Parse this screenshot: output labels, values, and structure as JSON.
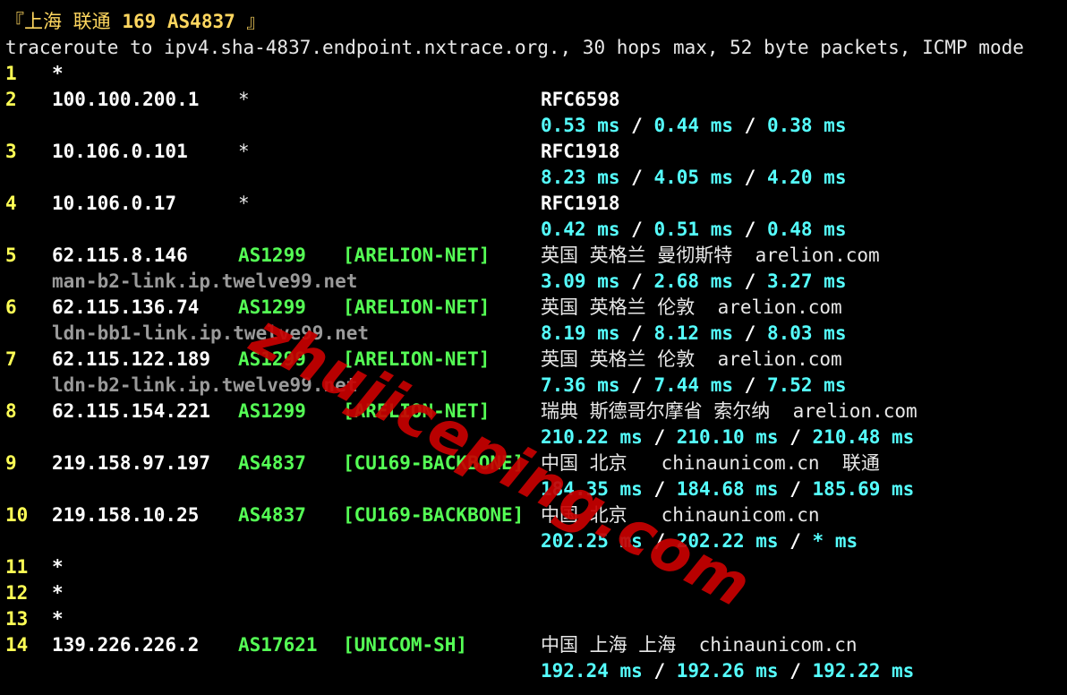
{
  "header": {
    "bracket_open": "『",
    "location": "上海 联通",
    "route": "169 AS4837",
    "bracket_close": "』"
  },
  "command_line": "traceroute to ipv4.sha-4837.endpoint.nxtrace.org., 30 hops max, 52 byte packets, ICMP mode",
  "hops": [
    {
      "num": "1",
      "ip": "*"
    },
    {
      "num": "2",
      "ip": "100.100.200.1",
      "asn": "*",
      "geo": "RFC6598",
      "rtt1": "0.53 ms",
      "rtt2": "0.44 ms",
      "rtt3": "0.38 ms",
      "sep": "/"
    },
    {
      "num": "3",
      "ip": "10.106.0.101",
      "asn": "*",
      "geo": "RFC1918",
      "rtt1": "8.23 ms",
      "rtt2": "4.05 ms",
      "rtt3": "4.20 ms",
      "sep": "/"
    },
    {
      "num": "4",
      "ip": "10.106.0.17",
      "asn": "*",
      "geo": "RFC1918",
      "rtt1": "0.42 ms",
      "rtt2": "0.51 ms",
      "rtt3": "0.48 ms",
      "sep": "/"
    },
    {
      "num": "5",
      "ip": "62.115.8.146",
      "asn": "AS1299",
      "net": "[ARELION-NET]",
      "geo": "英国 英格兰 曼彻斯特  arelion.com",
      "host": "man-b2-link.ip.twelve99.net",
      "rtt1": "3.09 ms",
      "rtt2": "2.68 ms",
      "rtt3": "3.27 ms",
      "sep": "/"
    },
    {
      "num": "6",
      "ip": "62.115.136.74",
      "asn": "AS1299",
      "net": "[ARELION-NET]",
      "geo": "英国 英格兰 伦敦  arelion.com",
      "host": "ldn-bb1-link.ip.twelve99.net",
      "rtt1": "8.19 ms",
      "rtt2": "8.12 ms",
      "rtt3": "8.03 ms",
      "sep": "/"
    },
    {
      "num": "7",
      "ip": "62.115.122.189",
      "asn": "AS1299",
      "net": "[ARELION-NET]",
      "geo": "英国 英格兰 伦敦  arelion.com",
      "host": "ldn-b2-link.ip.twelve99.net",
      "rtt1": "7.36 ms",
      "rtt2": "7.44 ms",
      "rtt3": "7.52 ms",
      "sep": "/"
    },
    {
      "num": "8",
      "ip": "62.115.154.221",
      "asn": "AS1299",
      "net": "[ARELION-NET]",
      "geo": "瑞典 斯德哥尔摩省 索尔纳  arelion.com",
      "rtt1": "210.22 ms",
      "rtt2": "210.10 ms",
      "rtt3": "210.48 ms",
      "sep": "/"
    },
    {
      "num": "9",
      "ip": "219.158.97.197",
      "asn": "AS4837",
      "net": "[CU169-BACKBONE]",
      "geo": "中国 北京   chinaunicom.cn  联通",
      "rtt1": "184.35 ms",
      "rtt2": "184.68 ms",
      "rtt3": "185.69 ms",
      "sep": "/"
    },
    {
      "num": "10",
      "ip": "219.158.10.25",
      "asn": "AS4837",
      "net": "[CU169-BACKBONE]",
      "geo": "中国 北京   chinaunicom.cn",
      "rtt1": "202.25 ms",
      "rtt2": "202.22 ms",
      "rtt3": "* ms",
      "sep": "/"
    },
    {
      "num": "11",
      "ip": "*"
    },
    {
      "num": "12",
      "ip": "*"
    },
    {
      "num": "13",
      "ip": "*"
    },
    {
      "num": "14",
      "ip": "139.226.226.2",
      "asn": "AS17621",
      "net": "[UNICOM-SH]",
      "geo": "中国 上海 上海  chinaunicom.cn",
      "rtt1": "192.24 ms",
      "rtt2": "192.26 ms",
      "rtt3": "192.22 ms",
      "sep": "/"
    }
  ],
  "watermark": "zhujiceping.com",
  "colors": {
    "background": "#000000",
    "hop_number": "#ffff55",
    "ip": "#ffffff",
    "asn": "#55ff55",
    "rtt": "#55ffff",
    "hostname": "#9a9a9a",
    "title": "#ffd75f",
    "watermark": "#c80000"
  }
}
